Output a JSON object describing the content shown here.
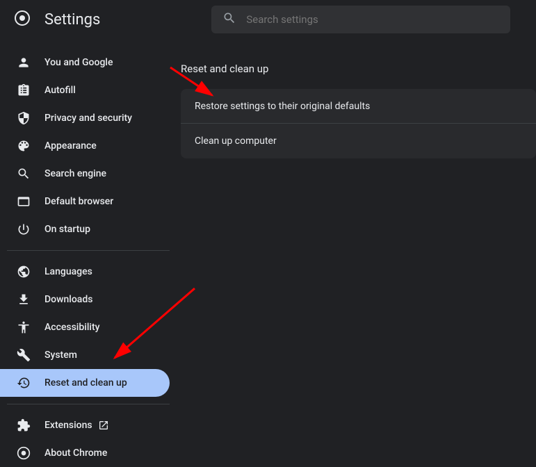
{
  "header": {
    "title": "Settings",
    "search_placeholder": "Search settings"
  },
  "sidebar": {
    "groups": [
      {
        "items": [
          {
            "id": "you-and-google",
            "label": "You and Google",
            "icon": "person"
          },
          {
            "id": "autofill",
            "label": "Autofill",
            "icon": "assignment"
          },
          {
            "id": "privacy",
            "label": "Privacy and security",
            "icon": "shield"
          },
          {
            "id": "appearance",
            "label": "Appearance",
            "icon": "palette"
          },
          {
            "id": "search-engine",
            "label": "Search engine",
            "icon": "search"
          },
          {
            "id": "default-browser",
            "label": "Default browser",
            "icon": "browser"
          },
          {
            "id": "on-startup",
            "label": "On startup",
            "icon": "power"
          }
        ]
      },
      {
        "items": [
          {
            "id": "languages",
            "label": "Languages",
            "icon": "globe"
          },
          {
            "id": "downloads",
            "label": "Downloads",
            "icon": "download"
          },
          {
            "id": "accessibility",
            "label": "Accessibility",
            "icon": "accessibility"
          },
          {
            "id": "system",
            "label": "System",
            "icon": "wrench"
          },
          {
            "id": "reset",
            "label": "Reset and clean up",
            "icon": "history",
            "selected": true
          }
        ]
      },
      {
        "items": [
          {
            "id": "extensions",
            "label": "Extensions",
            "icon": "extension",
            "external": true
          },
          {
            "id": "about",
            "label": "About Chrome",
            "icon": "chrome"
          }
        ]
      }
    ]
  },
  "main": {
    "section_title": "Reset and clean up",
    "rows": [
      {
        "id": "restore",
        "label": "Restore settings to their original defaults"
      },
      {
        "id": "cleanup",
        "label": "Clean up computer"
      }
    ]
  },
  "annotations": {
    "arrow_color": "#ff0000"
  }
}
